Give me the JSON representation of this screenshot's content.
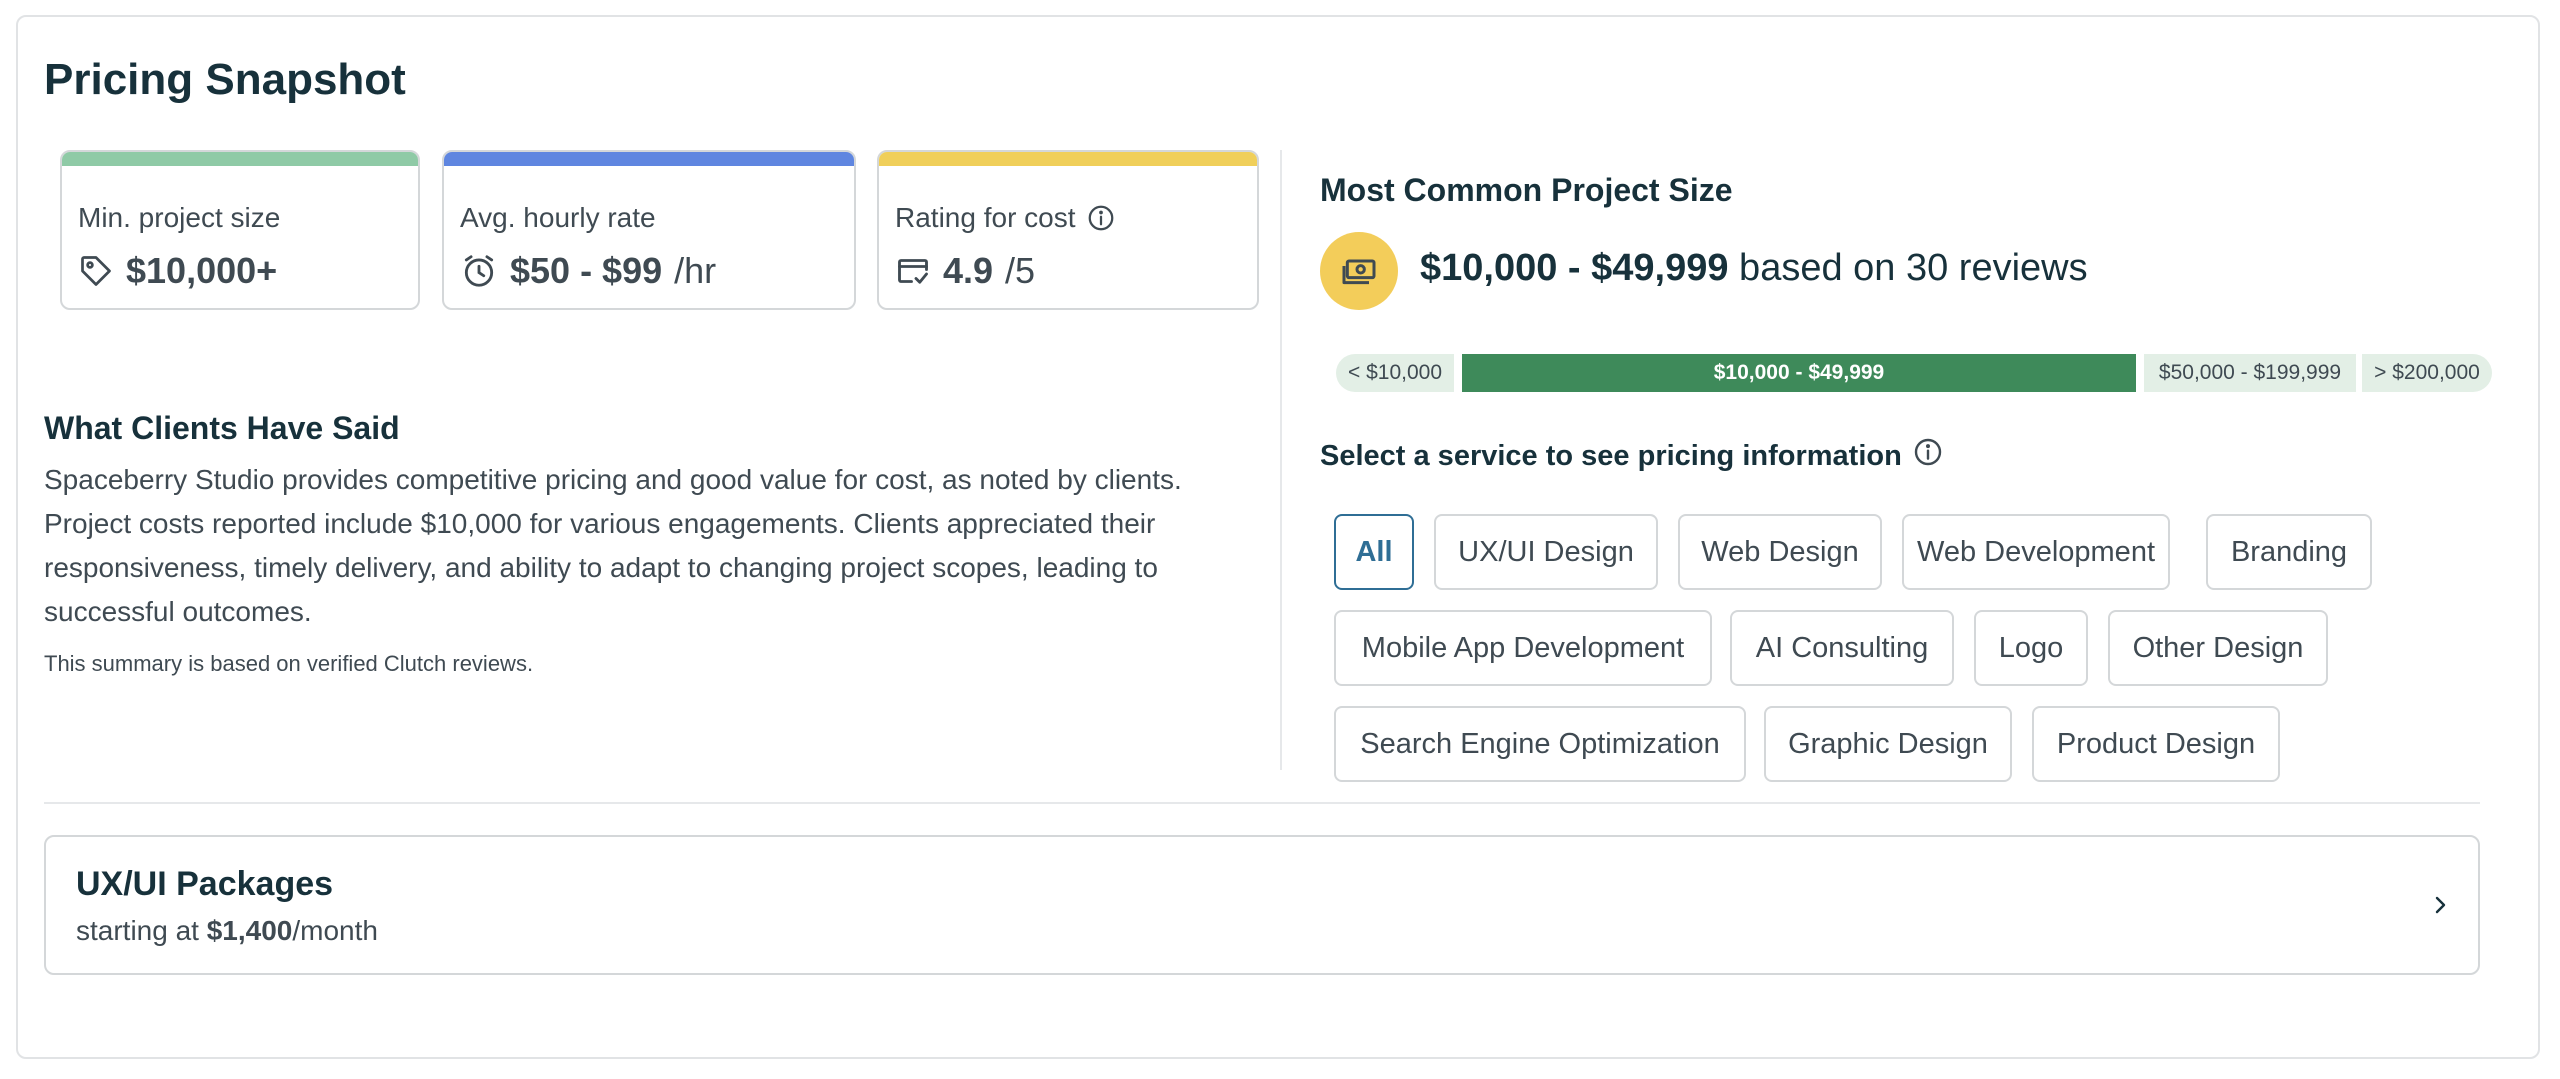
{
  "title": "Pricing Snapshot",
  "stats": [
    {
      "label": "Min. project size",
      "value": "$10,000+",
      "unit": "",
      "icon": "tag-icon",
      "color": "#8fcaa6"
    },
    {
      "label": "Avg. hourly rate",
      "value": "$50 - $99",
      "unit": "/hr",
      "icon": "clock-icon",
      "color": "#5f86e0"
    },
    {
      "label": "Rating for cost",
      "value": "4.9",
      "unit": "/5",
      "icon": "card-check-icon",
      "color": "#f0cf5a",
      "info_icon": "info-icon"
    }
  ],
  "clients": {
    "heading": "What Clients Have Said",
    "summary": "Spaceberry Studio provides competitive pricing and good value for cost, as noted by clients. Project costs reported include $10,000 for various engagements. Clients appreciated their responsiveness, timely delivery, and ability to adapt to changing project scopes, leading to successful outcomes.",
    "footnote": "This summary is based on verified Clutch reviews."
  },
  "common_size": {
    "heading": "Most Common Project Size",
    "range": "$10,000 - $49,999",
    "suffix": " based on 30 reviews",
    "icon": "money-icon",
    "distribution": [
      "< $10,000",
      "$10,000 - $49,999",
      "$50,000 - $199,999",
      "> $200,000"
    ],
    "active_index": 1
  },
  "services": {
    "label": "Select a service to see pricing information",
    "items": [
      "All",
      "UX/UI Design",
      "Web Design",
      "Web Development",
      "Branding",
      "Mobile App Development",
      "AI Consulting",
      "Logo",
      "Other Design",
      "Search Engine Optimization",
      "Graphic Design",
      "Product Design"
    ],
    "selected": "All"
  },
  "package": {
    "title": "UX/UI Packages",
    "prefix": "starting at ",
    "price": "$1,400",
    "suffix": "/month"
  }
}
